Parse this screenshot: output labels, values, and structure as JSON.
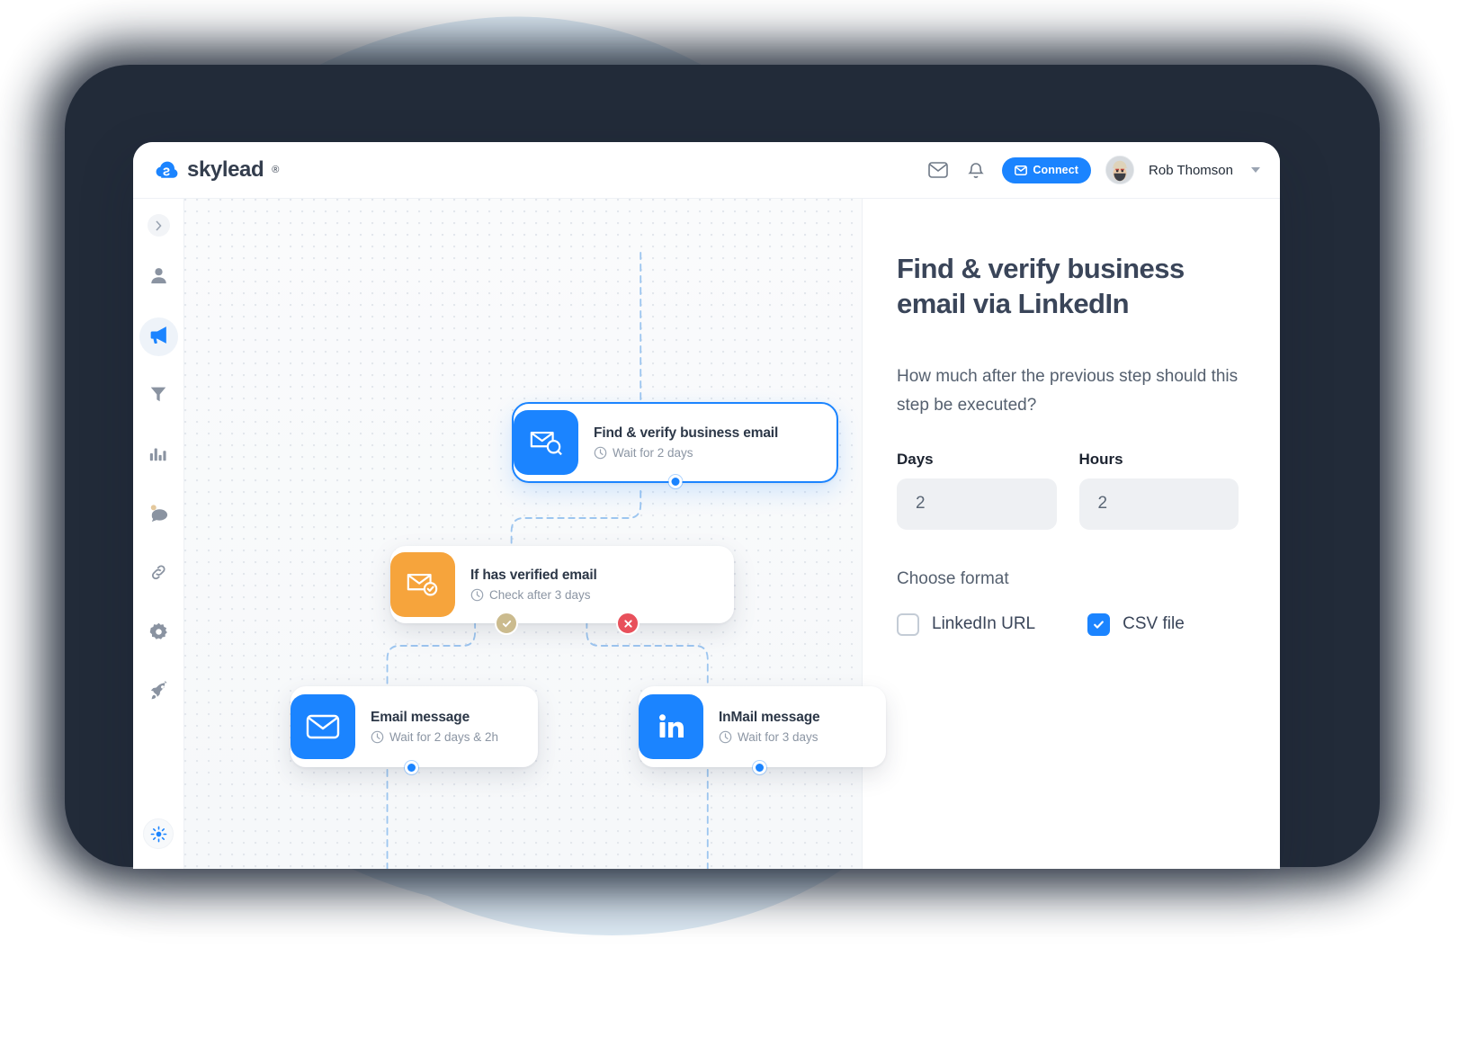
{
  "header": {
    "brand_name": "skylead",
    "brand_reg": "®",
    "logo_icon": "skylead-cloud-icon",
    "mail_icon": "mail-icon",
    "bell_icon": "bell-icon",
    "connect_label": "Connect",
    "connect_icon": "envelope-icon",
    "user_name": "Rob Thomson",
    "caret_icon": "chevron-down-icon"
  },
  "sidebar": {
    "collapse_icon": "chevron-right-icon",
    "items": [
      {
        "name": "sidebar-item-contacts",
        "icon": "user-icon",
        "active": false
      },
      {
        "name": "sidebar-item-campaigns",
        "icon": "megaphone-icon",
        "active": true
      },
      {
        "name": "sidebar-item-filters",
        "icon": "funnel-icon",
        "active": false
      },
      {
        "name": "sidebar-item-analytics",
        "icon": "bar-chart-icon",
        "active": false
      },
      {
        "name": "sidebar-item-inbox",
        "icon": "chat-bubble-icon",
        "active": false
      },
      {
        "name": "sidebar-item-integrations",
        "icon": "link-icon",
        "active": false
      },
      {
        "name": "sidebar-item-settings",
        "icon": "gear-icon",
        "active": false
      },
      {
        "name": "sidebar-item-launch",
        "icon": "rocket-icon",
        "active": false
      }
    ],
    "theme_icon": "sun-icon"
  },
  "canvas": {
    "nodes": [
      {
        "id": "find-verify-business-email",
        "title": "Find & verify business email",
        "subtitle": "Wait for 2 days",
        "clock_icon": "clock-icon",
        "icon": "mail-search-icon",
        "icon_color": "#1b84ff",
        "selected": true
      },
      {
        "id": "if-has-verified-email",
        "title": "If has verified email",
        "subtitle": "Check after  3 days",
        "clock_icon": "clock-icon",
        "icon": "mail-check-icon",
        "icon_color": "#f6a43c",
        "selected": false
      },
      {
        "id": "email-message",
        "title": "Email message",
        "subtitle": "Wait for 2 days & 2h",
        "clock_icon": "clock-icon",
        "icon": "envelope-icon",
        "icon_color": "#1b84ff",
        "selected": false
      },
      {
        "id": "inmail-message",
        "title": "InMail message",
        "subtitle": "Wait for 3 days",
        "clock_icon": "clock-icon",
        "icon": "linkedin-icon",
        "icon_color": "#1b84ff",
        "selected": false
      }
    ],
    "badges": [
      {
        "name": "branch-yes-badge",
        "icon": "check-icon",
        "color": "#cbbb8e"
      },
      {
        "name": "branch-no-badge",
        "icon": "x-icon",
        "color": "#e8505b"
      }
    ]
  },
  "panel": {
    "title": "Find & verify business email via LinkedIn",
    "question": "How much after the previous step should this step be executed?",
    "days_label": "Days",
    "days_value": "2",
    "hours_label": "Hours",
    "hours_value": "2",
    "format_label": "Choose format",
    "options": [
      {
        "label": "LinkedIn URL",
        "checked": false
      },
      {
        "label": "CSV file",
        "checked": true
      }
    ]
  },
  "colors": {
    "accent": "#1b84ff",
    "orange": "#f6a43c",
    "danger": "#e8505b",
    "yes_badge": "#cbbb8e",
    "device": "#222b39",
    "blob": "#dbe8f2",
    "text_dark": "#2c3747"
  }
}
